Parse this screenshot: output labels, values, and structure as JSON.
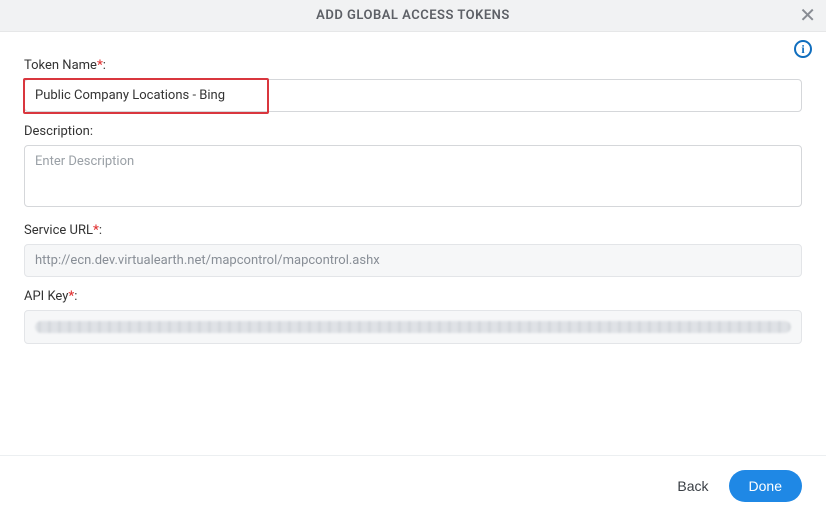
{
  "header": {
    "title": "ADD GLOBAL ACCESS TOKENS"
  },
  "form": {
    "tokenName": {
      "label": "Token Name",
      "value": "Public Company Locations - Bing"
    },
    "description": {
      "label": "Description:",
      "placeholder": "Enter Description",
      "value": ""
    },
    "serviceUrl": {
      "label": "Service URL",
      "value": "http://ecn.dev.virtualearth.net/mapcontrol/mapcontrol.ashx"
    },
    "apiKey": {
      "label": "API Key"
    }
  },
  "footer": {
    "back": "Back",
    "done": "Done"
  }
}
